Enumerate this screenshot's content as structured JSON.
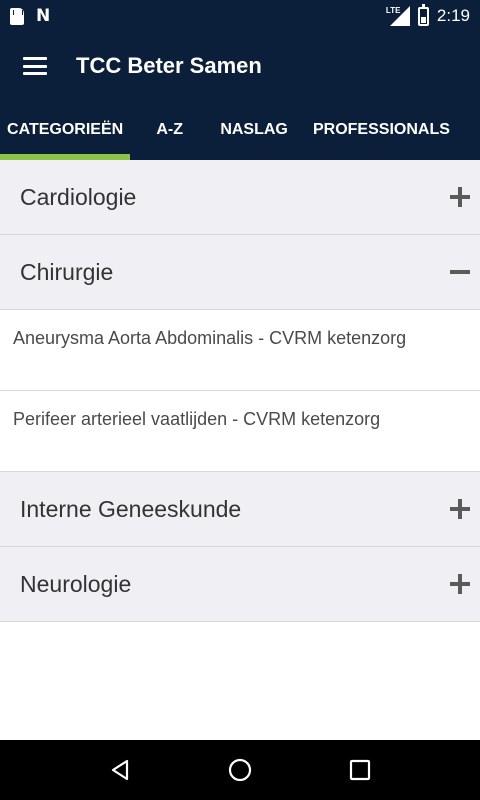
{
  "status_bar": {
    "left_icons": [
      "sd-card-icon",
      "n-notification-icon"
    ],
    "network_label": "LTE",
    "time": "2:19"
  },
  "app_bar": {
    "title": "TCC Beter Samen",
    "menu_icon": "menu-icon"
  },
  "tabs": [
    {
      "label": "CATEGORIEËN",
      "active": true
    },
    {
      "label": "A-Z",
      "active": false
    },
    {
      "label": "NASLAG",
      "active": false
    },
    {
      "label": "PROFESSIONALS",
      "active": false
    }
  ],
  "accent_color": "#8bc34a",
  "bar_color": "#0b1f3a",
  "categories": [
    {
      "label": "Cardiologie",
      "expanded": false,
      "items": []
    },
    {
      "label": "Chirurgie",
      "expanded": true,
      "items": [
        "Aneurysma Aorta Abdominalis - CVRM ketenzorg",
        "Perifeer arterieel vaatlijden - CVRM ketenzorg"
      ]
    },
    {
      "label": "Interne Geneeskunde",
      "expanded": false,
      "items": []
    },
    {
      "label": "Neurologie",
      "expanded": false,
      "items": []
    }
  ],
  "nav_bar": [
    "back-icon",
    "home-icon",
    "recents-icon"
  ]
}
